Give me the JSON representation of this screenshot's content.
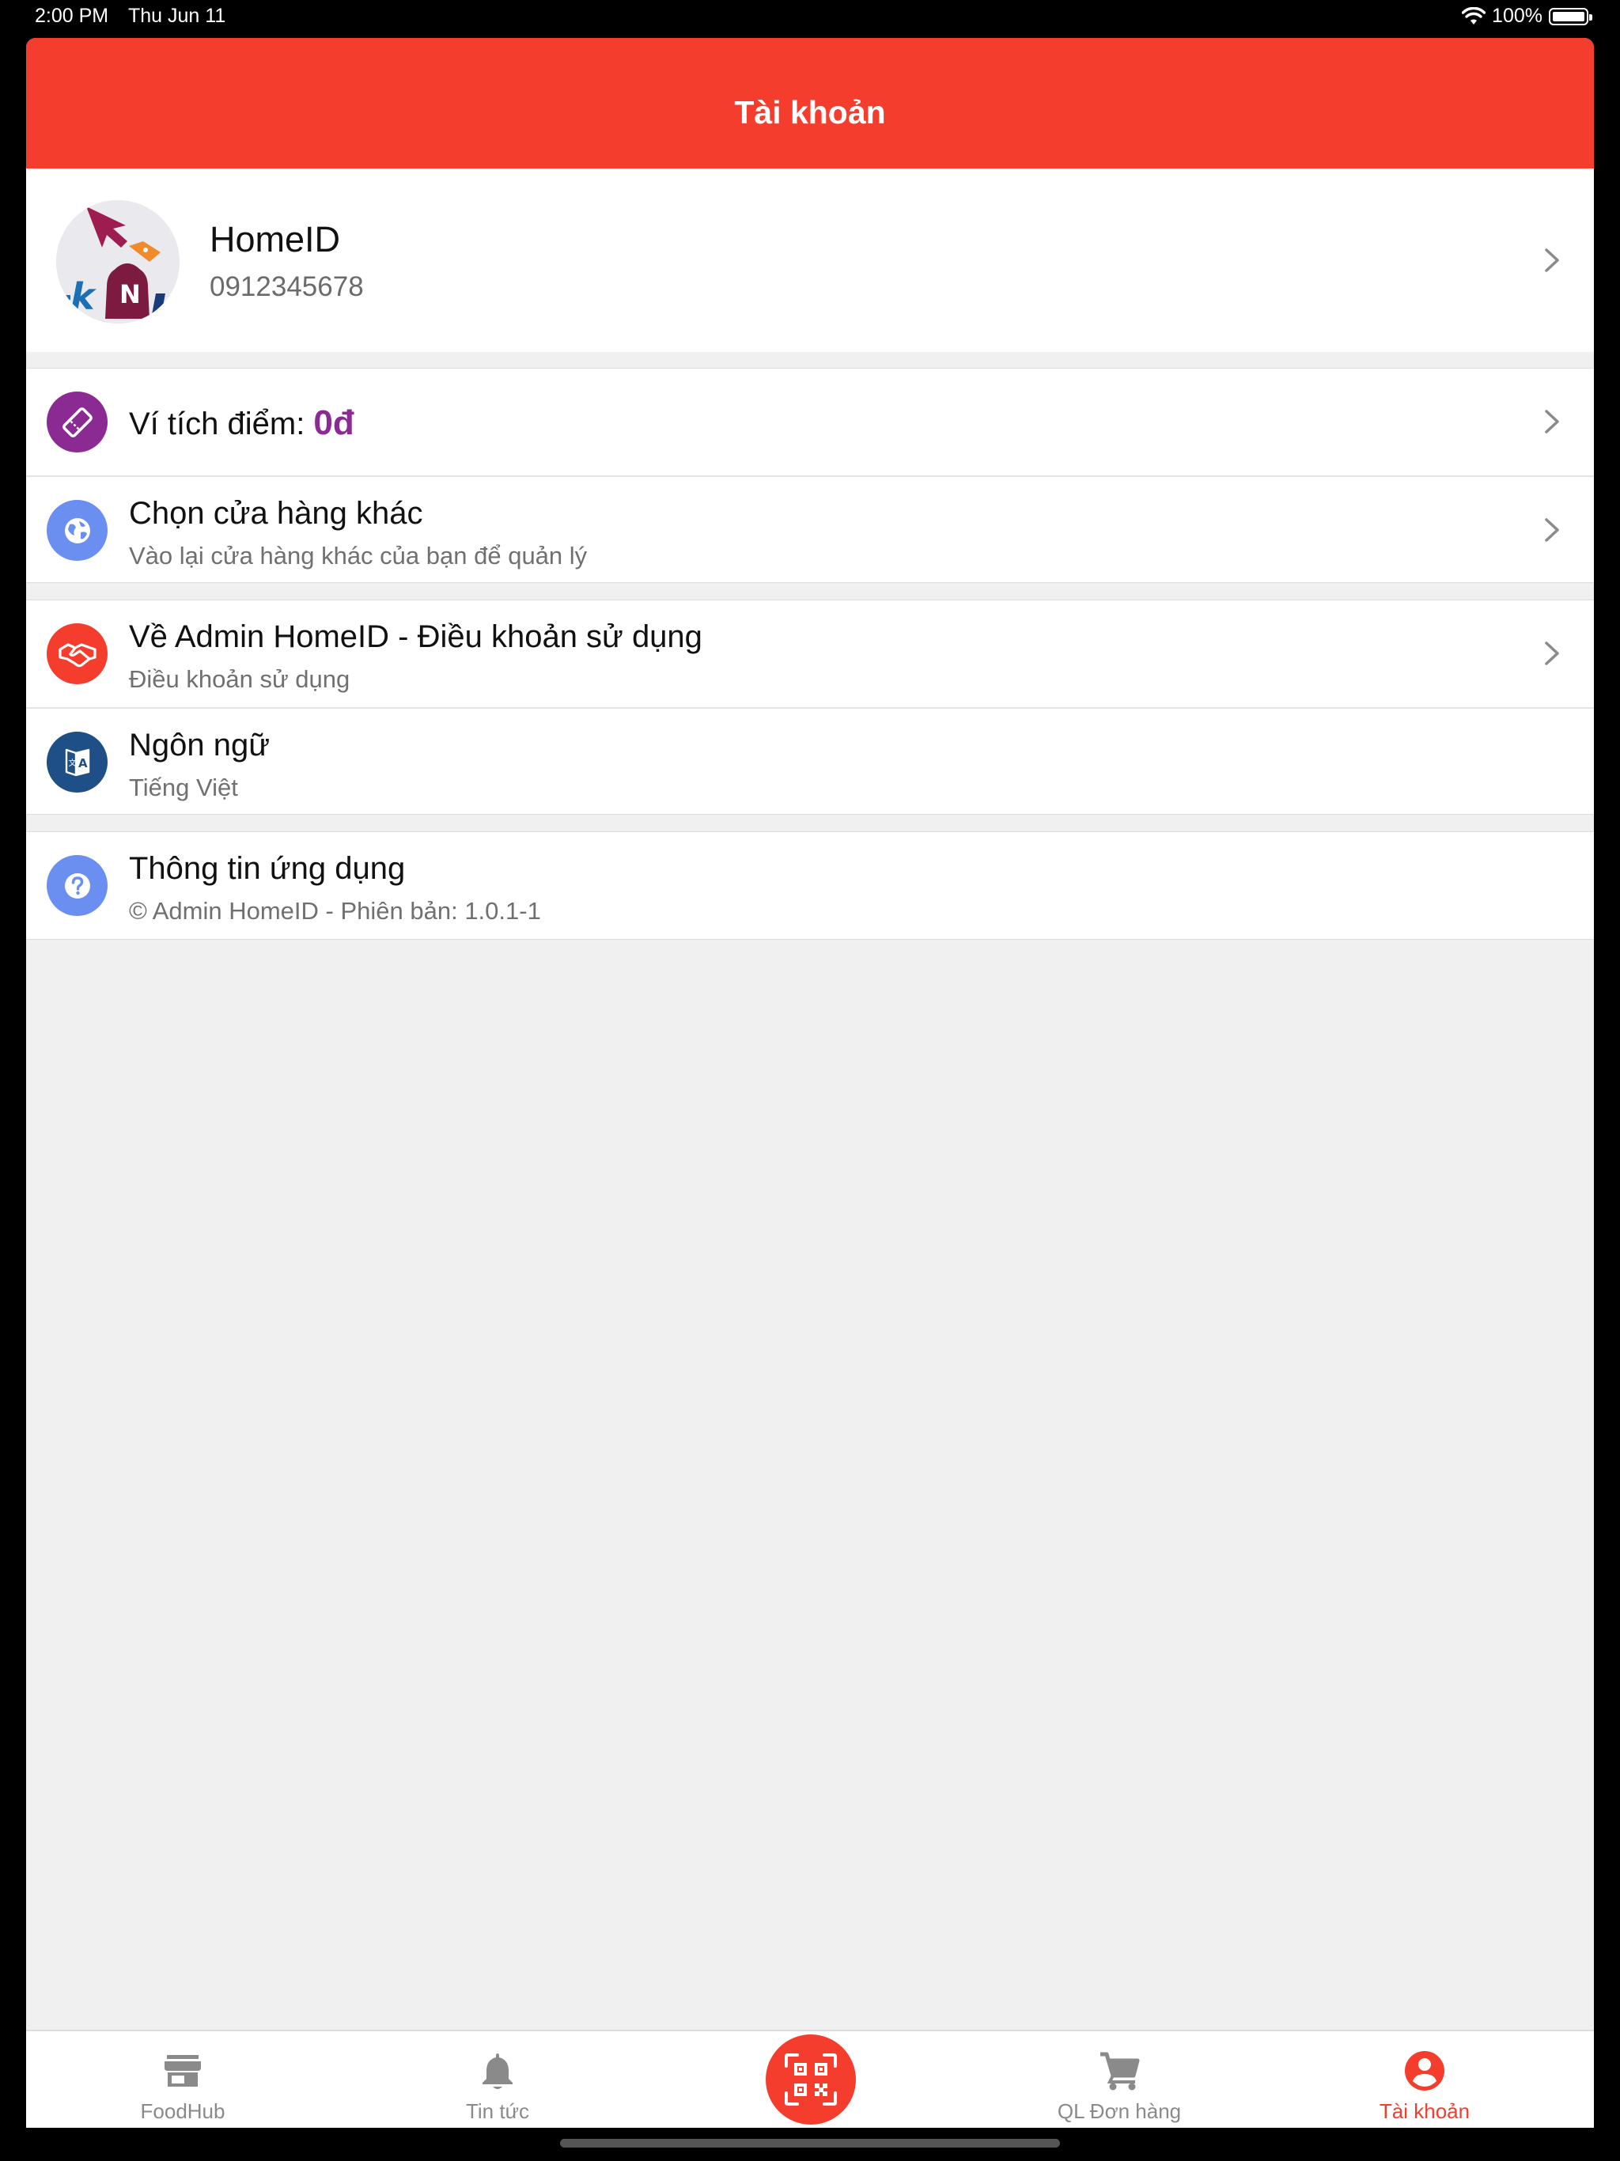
{
  "status_bar": {
    "time": "2:00 PM",
    "date": "Thu Jun 11",
    "battery": "100%"
  },
  "header": {
    "title": "Tài khoản"
  },
  "profile": {
    "name": "HomeID",
    "phone": "0912345678"
  },
  "menu": {
    "points": {
      "label": "Ví tích điểm: ",
      "value": "0đ"
    },
    "switch_store": {
      "title": "Chọn cửa hàng khác",
      "subtitle": "Vào lại cửa hàng khác của bạn để quản lý"
    },
    "about": {
      "title": "Về Admin HomeID - Điều khoản sử dụng",
      "subtitle": "Điều khoản sử dụng"
    },
    "language": {
      "title": "Ngôn ngữ",
      "subtitle": "Tiếng Việt"
    },
    "app_info": {
      "title": "Thông tin ứng dụng",
      "subtitle": "© Admin HomeID - Phiên bản: 1.0.1-1"
    }
  },
  "tabs": [
    {
      "label": "FoodHub",
      "icon": "store-icon",
      "active": false
    },
    {
      "label": "Tin tức",
      "icon": "bell-icon",
      "active": false
    },
    {
      "label": "",
      "icon": "qr-scan-icon",
      "active": false
    },
    {
      "label": "QL Đơn hàng",
      "icon": "cart-icon",
      "active": false
    },
    {
      "label": "Tài khoản",
      "icon": "account-circle-icon",
      "active": true
    }
  ],
  "colors": {
    "primary": "#f53d2d",
    "points_purple": "#8c2a94",
    "globe_blue": "#6a8ff0",
    "language_navy": "#1e4f86",
    "background": "#f0f0f0"
  }
}
